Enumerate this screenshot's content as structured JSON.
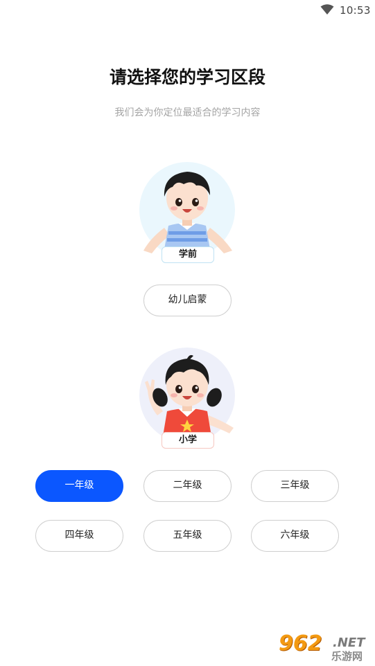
{
  "status_bar": {
    "time": "10:53",
    "wifi_icon": "wifi-icon"
  },
  "header": {
    "title": "请选择您的学习区段",
    "subtitle": "我们会为你定位最适合的学习内容"
  },
  "stages": {
    "preschool": {
      "tag": "学前",
      "circle_color": "#eaf7fd",
      "options": [
        "幼儿启蒙"
      ]
    },
    "primary": {
      "tag": "小学",
      "circle_color": "#eef0fa",
      "options": [
        "一年级",
        "二年级",
        "三年级",
        "四年级",
        "五年级",
        "六年级"
      ],
      "selected": "一年级"
    }
  },
  "colors": {
    "accent": "#0b57ff",
    "pill_border": "#cfcfcf",
    "subtitle": "#a4a4a4"
  },
  "watermark": {
    "number": "962",
    "net": ".NET",
    "site": "乐游网"
  }
}
